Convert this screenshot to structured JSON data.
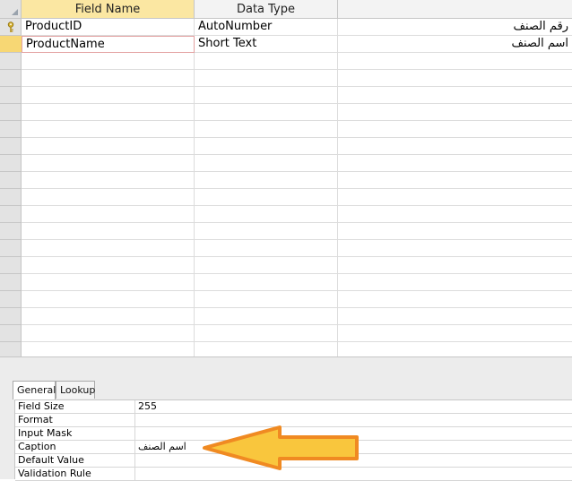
{
  "grid": {
    "columns": [
      "Field Name",
      "Data Type",
      ""
    ],
    "rows": [
      {
        "field_name": "ProductID",
        "data_type": "AutoNumber",
        "description": "رقم الصنف",
        "primary_key": true
      },
      {
        "field_name": "ProductName",
        "data_type": "Short Text",
        "description": "اسم الصنف",
        "primary_key": false
      }
    ]
  },
  "lower": {
    "tabs": [
      "General",
      "Lookup"
    ],
    "properties": [
      {
        "label": "Field Size",
        "value": "255"
      },
      {
        "label": "Format",
        "value": ""
      },
      {
        "label": "Input Mask",
        "value": ""
      },
      {
        "label": "Caption",
        "value": "اسم الصنف"
      },
      {
        "label": "Default Value",
        "value": ""
      },
      {
        "label": "Validation Rule",
        "value": ""
      }
    ]
  },
  "colors": {
    "selected_row": "#f7d774",
    "active_header": "#fbe7a2",
    "arrow_fill": "#f9c63d",
    "arrow_stroke": "#f08a22"
  },
  "icons": {
    "primary_key": "key-icon",
    "annotation": "left-arrow-annotation"
  }
}
